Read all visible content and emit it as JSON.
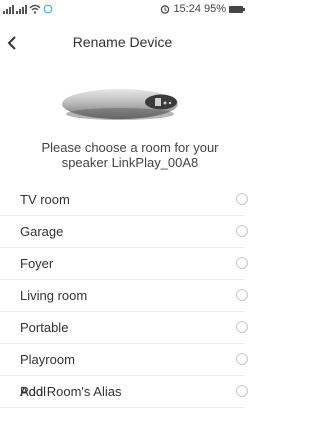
{
  "status_bar": {
    "time": "15:24",
    "battery": "95%",
    "icons": [
      "signal-icon",
      "signal-icon",
      "wifi-icon",
      "sync-icon",
      "alarm-icon",
      "battery-icon"
    ]
  },
  "header": {
    "back_icon": "chevron-left-icon",
    "title": "Rename Device"
  },
  "device": {
    "prompt": "Please choose a room for your speaker  LinkPlay_00A8"
  },
  "rooms": [
    {
      "label": "TV room",
      "selected": false
    },
    {
      "label": "Garage",
      "selected": false
    },
    {
      "label": "Foyer",
      "selected": false
    },
    {
      "label": "Living room",
      "selected": false
    },
    {
      "label": "Portable",
      "selected": false
    },
    {
      "label": "Playroom",
      "selected": false
    },
    {
      "label": "Pool",
      "selected": false
    }
  ],
  "alias_link": "Add Room's Alias",
  "colors": {
    "background": "#ffffff",
    "text": "#333333",
    "radio_border": "#c8c8c8"
  }
}
